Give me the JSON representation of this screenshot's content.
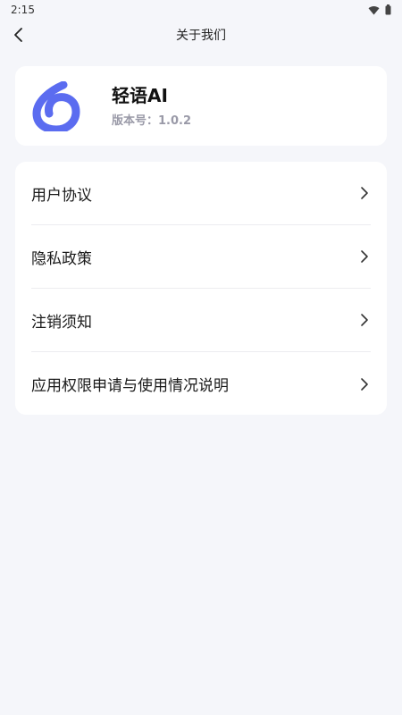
{
  "status_bar": {
    "time": "2:15",
    "icons": [
      "wifi-icon",
      "battery-icon"
    ]
  },
  "nav": {
    "title": "关于我们",
    "back_icon": "chevron-left-icon"
  },
  "app": {
    "name": "轻语AI",
    "version": "版本号：1.0.2",
    "logo_color": "#5b6cf0"
  },
  "menu": {
    "items": [
      {
        "label": "用户协议"
      },
      {
        "label": "隐私政策"
      },
      {
        "label": "注销须知"
      },
      {
        "label": "应用权限申请与使用情况说明"
      }
    ]
  },
  "colors": {
    "background": "#f5f6fa",
    "card": "#ffffff",
    "accent": "#5b6cf0",
    "muted": "#9a9aa8"
  }
}
